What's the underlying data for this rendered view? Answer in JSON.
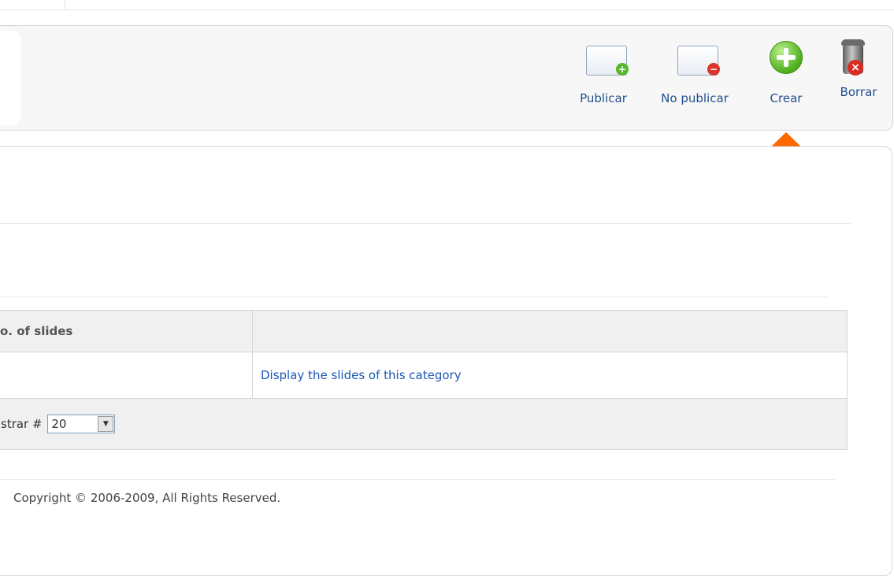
{
  "toolbar": {
    "buttons": [
      {
        "label": "Publicar",
        "icon": "publish-icon"
      },
      {
        "label": "No publicar",
        "icon": "unpublish-icon"
      },
      {
        "label": "Crear",
        "icon": "add-icon"
      },
      {
        "label": "Borrar",
        "icon": "trash-icon"
      }
    ]
  },
  "table": {
    "headers": [
      "o. of slides",
      ""
    ],
    "rows": [
      {
        "slides": "",
        "action_link": "Display the slides of this category"
      }
    ],
    "pager": {
      "label": "strar #",
      "value": "20"
    }
  },
  "footer": {
    "copyright": "Copyright © 2006-2009, All Rights Reserved."
  },
  "colors": {
    "link": "#1a57b3",
    "arrow": "#ff6a00",
    "add_icon": "#4fae1d",
    "delete_badge": "#d9332b"
  }
}
